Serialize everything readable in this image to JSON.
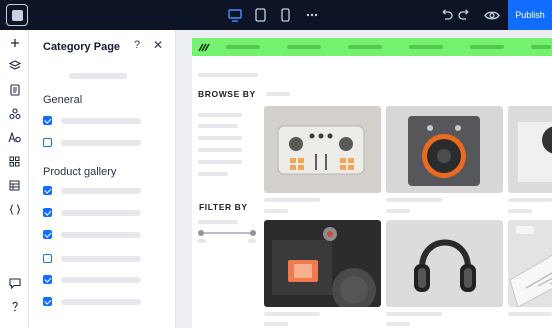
{
  "topbar": {
    "publish_label": "Publish"
  },
  "panel": {
    "title": "Category Page",
    "help": "?",
    "close": "✕",
    "sections": [
      {
        "title": "General",
        "items": [
          {
            "checked": true
          },
          {
            "checked": false
          }
        ]
      },
      {
        "title": "Product gallery",
        "items": [
          {
            "checked": true
          },
          {
            "checked": true
          },
          {
            "checked": true
          },
          {
            "checked": false
          },
          {
            "checked": true
          },
          {
            "checked": true
          }
        ]
      }
    ]
  },
  "site": {
    "browse_by": "BROWSE BY",
    "filter_by": "FILTER BY",
    "products": [
      {
        "name": "dj-controller"
      },
      {
        "name": "speaker"
      },
      {
        "name": "turntable"
      },
      {
        "name": "sampler-pad"
      },
      {
        "name": "headphones"
      },
      {
        "name": "keyboard"
      }
    ]
  },
  "colors": {
    "accent": "#116dff",
    "topbar": "#0c1425",
    "site_header": "#74f26f"
  }
}
